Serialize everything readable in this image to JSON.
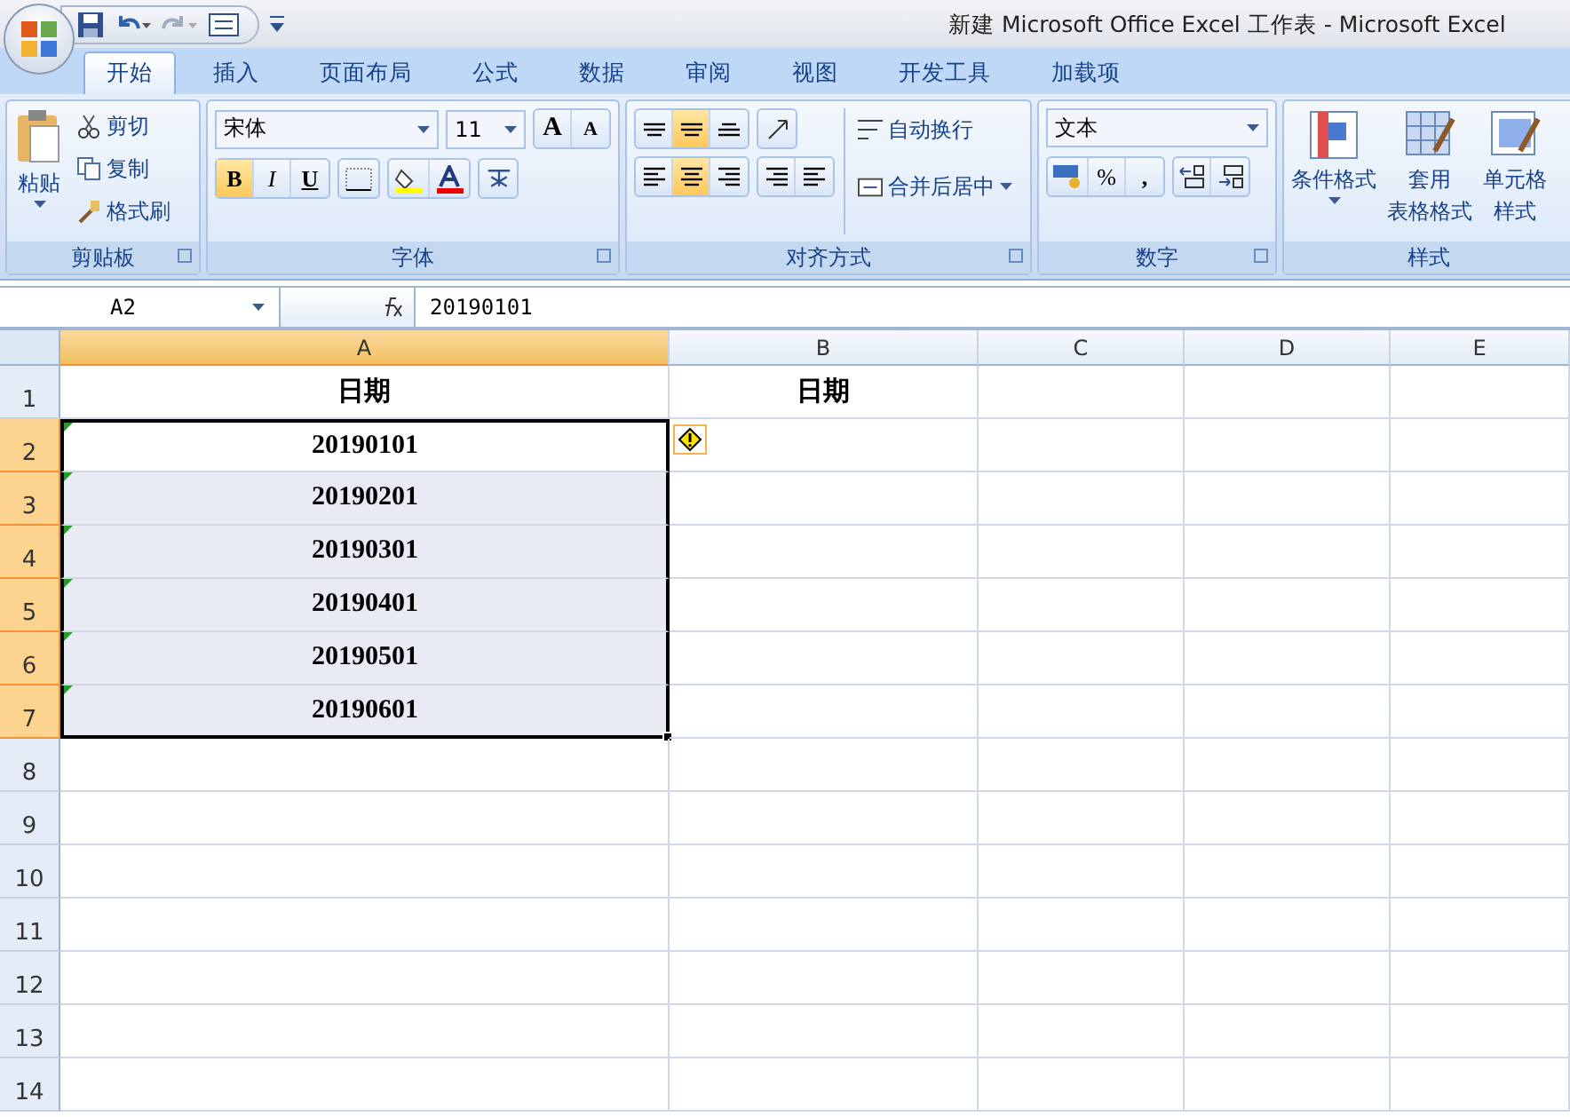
{
  "window": {
    "title": "新建 Microsoft Office Excel 工作表 - Microsoft Excel"
  },
  "tabs": [
    {
      "label": "开始",
      "selected": true
    },
    {
      "label": "插入",
      "selected": false
    },
    {
      "label": "页面布局",
      "selected": false
    },
    {
      "label": "公式",
      "selected": false
    },
    {
      "label": "数据",
      "selected": false
    },
    {
      "label": "审阅",
      "selected": false
    },
    {
      "label": "视图",
      "selected": false
    },
    {
      "label": "开发工具",
      "selected": false
    },
    {
      "label": "加载项",
      "selected": false
    }
  ],
  "ribbon": {
    "clipboard": {
      "paste": "粘贴",
      "cut": "剪切",
      "copy": "复制",
      "format_painter": "格式刷",
      "label": "剪贴板"
    },
    "font": {
      "name": "宋体",
      "size": "11",
      "grow": "A",
      "shrink": "A",
      "toggles": [
        {
          "kind": "bold",
          "label": "B",
          "selected": true
        },
        {
          "kind": "italic",
          "label": "I",
          "selected": false
        },
        {
          "kind": "underline",
          "label": "U",
          "selected": false
        }
      ],
      "label": "字体"
    },
    "alignment": {
      "vertical": [
        {
          "kind": "top",
          "selected": false
        },
        {
          "kind": "middle",
          "selected": true
        },
        {
          "kind": "bottom",
          "selected": false
        }
      ],
      "horizontal": [
        {
          "kind": "left",
          "selected": false
        },
        {
          "kind": "center",
          "selected": true
        },
        {
          "kind": "right",
          "selected": false
        }
      ],
      "wrap": "自动换行",
      "merge": "合并后居中",
      "label": "对齐方式"
    },
    "number": {
      "format": "文本",
      "percent": "%",
      "comma": ",",
      "label": "数字"
    },
    "styles": {
      "conditional": "条件格式",
      "table": [
        "套用",
        "表格格式"
      ],
      "cell": [
        "单元格",
        "样式"
      ],
      "label": "样式"
    }
  },
  "formula_bar": {
    "name_box": "A2",
    "formula": "20190101"
  },
  "columns": [
    {
      "label": "A",
      "selected": true
    },
    {
      "label": "B",
      "selected": false
    },
    {
      "label": "C",
      "selected": false
    },
    {
      "label": "D",
      "selected": false
    },
    {
      "label": "E",
      "selected": false
    }
  ],
  "rows": [
    {
      "header": "1",
      "selected": false,
      "cells": [
        "日期",
        "日期"
      ]
    },
    {
      "header": "2",
      "selected": true,
      "active": true,
      "error_flag": true,
      "warning": true,
      "cells": [
        "20190101"
      ]
    },
    {
      "header": "3",
      "selected": true,
      "active": false,
      "error_flag": true,
      "cells": [
        "20190201"
      ]
    },
    {
      "header": "4",
      "selected": true,
      "active": false,
      "error_flag": true,
      "cells": [
        "20190301"
      ]
    },
    {
      "header": "5",
      "selected": true,
      "active": false,
      "error_flag": true,
      "cells": [
        "20190401"
      ]
    },
    {
      "header": "6",
      "selected": true,
      "active": false,
      "error_flag": true,
      "cells": [
        "20190501"
      ]
    },
    {
      "header": "7",
      "selected": true,
      "active": false,
      "error_flag": true,
      "cells": [
        "20190601"
      ]
    },
    {
      "header": "8",
      "selected": false,
      "cells": []
    },
    {
      "header": "9",
      "selected": false,
      "cells": []
    },
    {
      "header": "10",
      "selected": false,
      "cells": []
    },
    {
      "header": "11",
      "selected": false,
      "cells": []
    },
    {
      "header": "12",
      "selected": false,
      "cells": []
    },
    {
      "header": "13",
      "selected": false,
      "cells": []
    },
    {
      "header": "14",
      "selected": false,
      "cells": []
    }
  ]
}
